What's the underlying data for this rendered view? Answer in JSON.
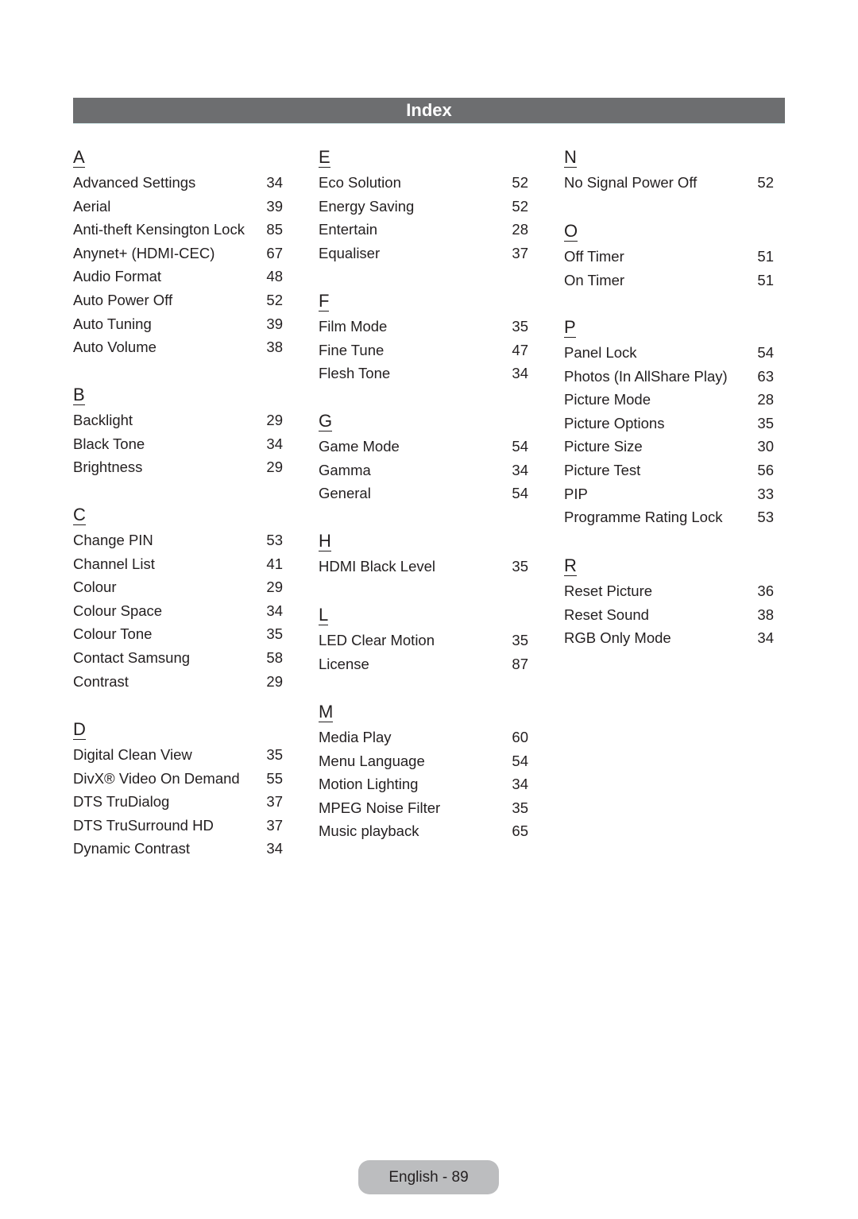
{
  "header": {
    "title": "Index"
  },
  "columns": [
    {
      "sections": [
        {
          "letter": "A",
          "entries": [
            {
              "term": "Advanced Settings",
              "page": "34"
            },
            {
              "term": "Aerial",
              "page": "39"
            },
            {
              "term": "Anti-theft Kensington Lock",
              "page": "85"
            },
            {
              "term": "Anynet+ (HDMI-CEC)",
              "page": "67"
            },
            {
              "term": "Audio Format",
              "page": "48"
            },
            {
              "term": "Auto Power Off",
              "page": "52"
            },
            {
              "term": "Auto Tuning",
              "page": "39"
            },
            {
              "term": "Auto Volume",
              "page": "38"
            }
          ]
        },
        {
          "letter": "B",
          "entries": [
            {
              "term": "Backlight",
              "page": "29"
            },
            {
              "term": "Black Tone",
              "page": "34"
            },
            {
              "term": "Brightness",
              "page": "29"
            }
          ]
        },
        {
          "letter": "C",
          "entries": [
            {
              "term": "Change PIN",
              "page": "53"
            },
            {
              "term": "Channel List",
              "page": "41"
            },
            {
              "term": "Colour",
              "page": "29"
            },
            {
              "term": "Colour Space",
              "page": "34"
            },
            {
              "term": "Colour Tone",
              "page": "35"
            },
            {
              "term": "Contact Samsung",
              "page": "58"
            },
            {
              "term": "Contrast",
              "page": "29"
            }
          ]
        },
        {
          "letter": "D",
          "entries": [
            {
              "term": "Digital Clean View",
              "page": "35"
            },
            {
              "term": "DivX® Video On Demand",
              "page": "55"
            },
            {
              "term": "DTS TruDialog",
              "page": "37"
            },
            {
              "term": "DTS TruSurround HD",
              "page": "37"
            },
            {
              "term": "Dynamic Contrast",
              "page": "34"
            }
          ]
        }
      ]
    },
    {
      "sections": [
        {
          "letter": "E",
          "entries": [
            {
              "term": "Eco Solution",
              "page": "52"
            },
            {
              "term": "Energy Saving",
              "page": "52"
            },
            {
              "term": "Entertain",
              "page": "28"
            },
            {
              "term": "Equaliser",
              "page": "37"
            }
          ]
        },
        {
          "letter": "F",
          "entries": [
            {
              "term": "Film Mode",
              "page": "35"
            },
            {
              "term": "Fine Tune",
              "page": "47"
            },
            {
              "term": "Flesh Tone",
              "page": "34"
            }
          ]
        },
        {
          "letter": "G",
          "entries": [
            {
              "term": "Game Mode",
              "page": "54"
            },
            {
              "term": "Gamma",
              "page": "34"
            },
            {
              "term": "General",
              "page": "54"
            }
          ]
        },
        {
          "letter": "H",
          "entries": [
            {
              "term": "HDMI Black Level",
              "page": "35"
            }
          ]
        },
        {
          "letter": "L",
          "entries": [
            {
              "term": "LED Clear Motion",
              "page": "35"
            },
            {
              "term": "License",
              "page": "87"
            }
          ]
        },
        {
          "letter": "M",
          "entries": [
            {
              "term": "Media Play",
              "page": "60"
            },
            {
              "term": "Menu Language",
              "page": "54"
            },
            {
              "term": "Motion Lighting",
              "page": "34"
            },
            {
              "term": "MPEG Noise Filter",
              "page": "35"
            },
            {
              "term": "Music playback",
              "page": "65"
            }
          ]
        }
      ]
    },
    {
      "sections": [
        {
          "letter": "N",
          "entries": [
            {
              "term": "No Signal Power Off",
              "page": "52"
            }
          ]
        },
        {
          "letter": "O",
          "entries": [
            {
              "term": "Off Timer",
              "page": "51"
            },
            {
              "term": "On Timer",
              "page": "51"
            }
          ]
        },
        {
          "letter": "P",
          "entries": [
            {
              "term": "Panel Lock",
              "page": "54"
            },
            {
              "term": "Photos (In AllShare Play)",
              "page": "63"
            },
            {
              "term": "Picture Mode",
              "page": "28"
            },
            {
              "term": "Picture Options",
              "page": "35"
            },
            {
              "term": "Picture Size",
              "page": "30"
            },
            {
              "term": "Picture Test",
              "page": "56"
            },
            {
              "term": "PIP",
              "page": "33"
            },
            {
              "term": "Programme Rating Lock",
              "page": "53"
            }
          ]
        },
        {
          "letter": "R",
          "entries": [
            {
              "term": "Reset Picture",
              "page": "36"
            },
            {
              "term": "Reset Sound",
              "page": "38"
            },
            {
              "term": "RGB Only Mode",
              "page": "34"
            }
          ]
        }
      ]
    }
  ],
  "footer": {
    "page_label": "English - 89"
  }
}
